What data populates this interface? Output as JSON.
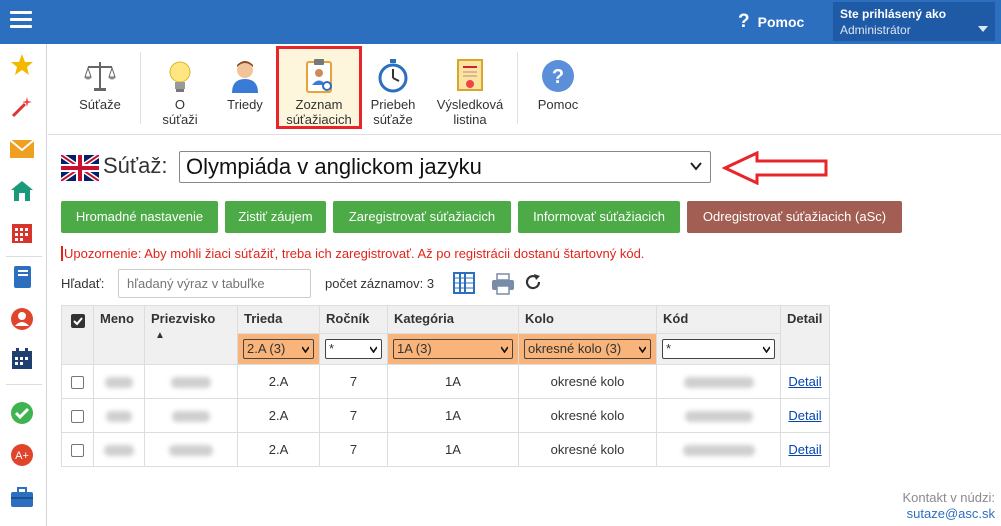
{
  "header": {
    "help_label": "Pomoc",
    "help_symbol": "?",
    "user_prefix": "Ste prihlásený ako",
    "user_name": "Administrátor"
  },
  "leftnav_icons": [
    "star-icon",
    "magic-wand-icon",
    "envelope-icon",
    "home-icon",
    "calendar-grid-icon",
    "notebook-icon",
    "person-circle-icon",
    "schedule-icon",
    "checkmark-circle-icon",
    "award-icon",
    "briefcase-icon"
  ],
  "toolbar": {
    "items": [
      {
        "label": "Súťaže",
        "icon": "scales-icon"
      },
      {
        "label": "O súťaži",
        "icon": "lightbulb-icon"
      },
      {
        "label": "Triedy",
        "icon": "person-icon"
      },
      {
        "label": "Zoznam súťažiacich",
        "icon": "clipboard-person-icon"
      },
      {
        "label": "Priebeh súťaže",
        "icon": "stopwatch-icon"
      },
      {
        "label": "Výsledková listina",
        "icon": "certificate-icon"
      },
      {
        "label": "Pomoc",
        "icon": "help-circle-icon"
      }
    ]
  },
  "competition": {
    "label": "Súťaž:",
    "selected": "Olympiáda v anglickom jazyku"
  },
  "actions": {
    "hromadne": "Hromadné nastavenie",
    "zistit": "Zistiť záujem",
    "zaregistrovat": "Zaregistrovať súťažiacich",
    "informovat": "Informovať súťažiacich",
    "odregistrovat": "Odregistrovať súťažiacich (aSc)"
  },
  "warning": "Upozornenie: Aby mohli žiaci súťažiť, treba ich zaregistrovať. Až po registrácii dostanú štartovný kód.",
  "search": {
    "label": "Hľadať:",
    "placeholder": "hľadaný výraz v tabuľke",
    "count_text": "počet záznamov: 3"
  },
  "table": {
    "headers": {
      "meno": "Meno",
      "priezvisko": "Priezvisko",
      "trieda": "Trieda",
      "rocnik": "Ročník",
      "kategoria": "Kategória",
      "kolo": "Kolo",
      "kod": "Kód",
      "detail": "Detail"
    },
    "sort_indicator": "▲",
    "filters": {
      "trieda": "2.A (3)",
      "rocnik": "*",
      "kategoria": "1A (3)",
      "kolo": "okresné kolo (3)",
      "kod": "*"
    },
    "rows": [
      {
        "trieda": "2.A",
        "rocnik": "7",
        "kategoria": "1A",
        "kolo": "okresné kolo",
        "detail": "Detail"
      },
      {
        "trieda": "2.A",
        "rocnik": "7",
        "kategoria": "1A",
        "kolo": "okresné kolo",
        "detail": "Detail"
      },
      {
        "trieda": "2.A",
        "rocnik": "7",
        "kategoria": "1A",
        "kolo": "okresné kolo",
        "detail": "Detail"
      }
    ]
  },
  "contact": {
    "line1": "Kontakt v núdzi:",
    "line2": "sutaze@asc.sk"
  },
  "colors": {
    "topbar": "#2d6fbf",
    "green_button": "#4caa47",
    "brown_button": "#a25e52",
    "filter_active": "#f8b47a",
    "warning": "#e2231a",
    "highlight_border": "#e8252a"
  }
}
